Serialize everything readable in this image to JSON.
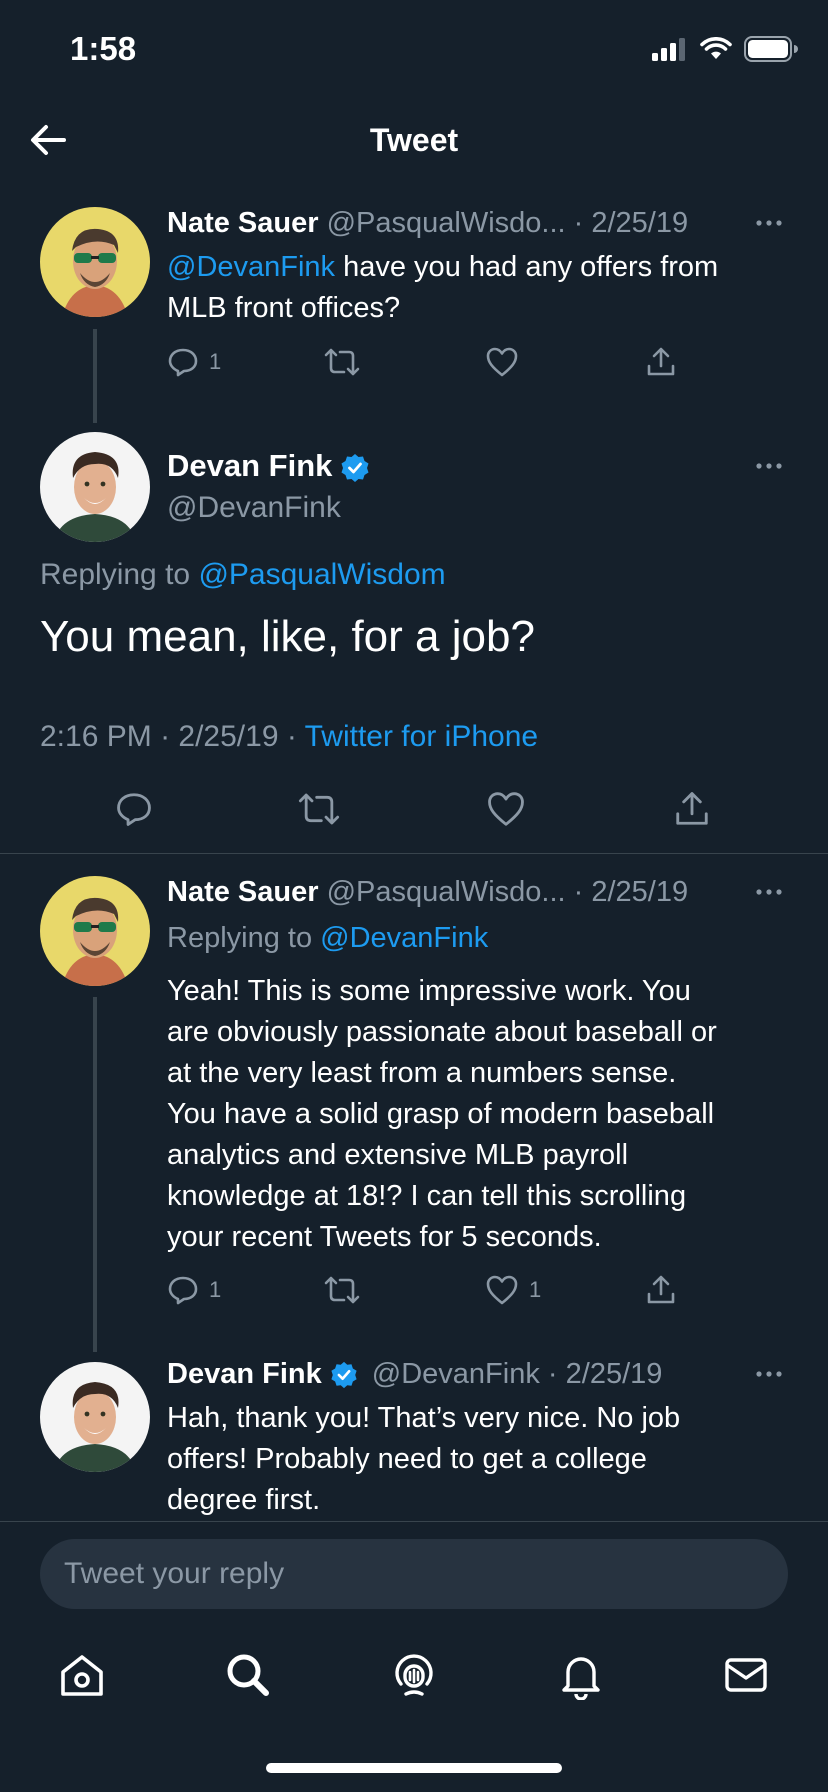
{
  "status_bar": {
    "time": "1:58"
  },
  "nav": {
    "title": "Tweet"
  },
  "tweet1": {
    "name": "Nate Sauer",
    "handle": "@PasqualWisdo...",
    "sep": "·",
    "date": "2/25/19",
    "mention": "@DevanFink",
    "text_line1": " have you had any offers from",
    "text_line2": "MLB front offices?",
    "reply_count": "1"
  },
  "main": {
    "name": "Devan Fink",
    "handle": "@DevanFink",
    "replying_prefix": "Replying to ",
    "replying_to": "@PasqualWisdom",
    "text": "You mean, like, for a job?",
    "time": "2:16 PM",
    "sep": " · ",
    "date": "2/25/19",
    "source": "Twitter for iPhone"
  },
  "tweet3": {
    "name": "Nate Sauer",
    "handle": "@PasqualWisdo...",
    "sep": "·",
    "date": "2/25/19",
    "replying_prefix": "Replying to ",
    "replying_to": "@DevanFink",
    "lines": [
      "Yeah! This is some impressive work. You",
      "are obviously passionate about baseball or",
      "at the very least from a numbers sense.",
      "You have a solid grasp of modern baseball",
      "analytics and extensive MLB payroll",
      "knowledge at 18!? I can tell this scrolling",
      "your recent Tweets for 5 seconds."
    ],
    "reply_count": "1",
    "like_count": "1"
  },
  "tweet4": {
    "name": "Devan Fink",
    "handle": "@DevanFink",
    "sep": "·",
    "date": "2/25/19",
    "lines": [
      "Hah, thank you! That’s very nice. No job",
      "offers! Probably need to get a college",
      "degree first."
    ]
  },
  "reply": {
    "placeholder": "Tweet your reply"
  },
  "colors": {
    "background": "#15202b",
    "accent": "#1d9bf0",
    "muted": "#8b98a5",
    "divider": "#38444d"
  },
  "icons": [
    "back-arrow-icon",
    "reply-icon",
    "retweet-icon",
    "like-icon",
    "share-icon",
    "more-icon",
    "verified-icon",
    "home-icon",
    "search-icon",
    "spaces-icon",
    "notifications-icon",
    "messages-icon"
  ]
}
